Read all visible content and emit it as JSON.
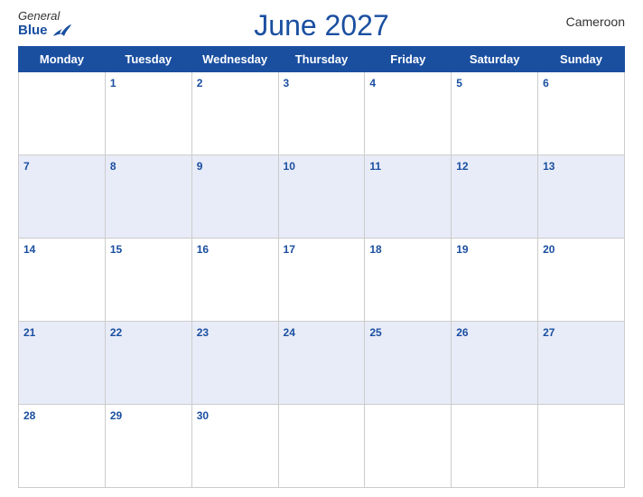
{
  "header": {
    "logo_general": "General",
    "logo_blue": "Blue",
    "title": "June 2027",
    "country": "Cameroon"
  },
  "days_of_week": [
    "Monday",
    "Tuesday",
    "Wednesday",
    "Thursday",
    "Friday",
    "Saturday",
    "Sunday"
  ],
  "weeks": [
    [
      null,
      1,
      2,
      3,
      4,
      5,
      6
    ],
    [
      7,
      8,
      9,
      10,
      11,
      12,
      13
    ],
    [
      14,
      15,
      16,
      17,
      18,
      19,
      20
    ],
    [
      21,
      22,
      23,
      24,
      25,
      26,
      27
    ],
    [
      28,
      29,
      30,
      null,
      null,
      null,
      null
    ]
  ]
}
